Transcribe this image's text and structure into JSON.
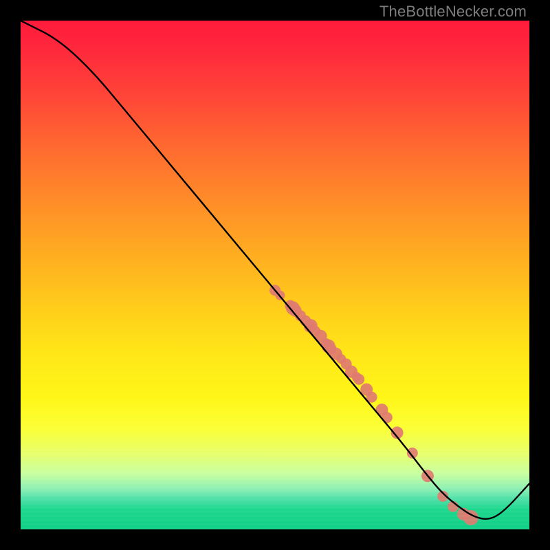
{
  "watermark": "TheBottleNecker.com",
  "chart_data": {
    "type": "line",
    "title": "",
    "xlabel": "",
    "ylabel": "",
    "xlim": [
      0,
      100
    ],
    "ylim": [
      0,
      100
    ],
    "grid": false,
    "legend": false,
    "background_gradient": {
      "top": "#ff1a3c",
      "mid": "#ffd21a",
      "bottom": "#10cf86"
    },
    "series": [
      {
        "name": "curve",
        "color": "#000000",
        "x": [
          0,
          3,
          6,
          10,
          15,
          20,
          25,
          30,
          35,
          40,
          45,
          50,
          55,
          60,
          65,
          70,
          75,
          80,
          83,
          86,
          89,
          92,
          95,
          100
        ],
        "y": [
          100,
          98.5,
          97,
          94,
          89,
          83,
          77,
          71,
          65,
          59,
          53,
          47,
          41,
          35,
          29,
          23,
          17,
          10.5,
          7,
          4.5,
          2.5,
          1.8,
          3.5,
          9
        ]
      }
    ],
    "points": {
      "name": "data-points",
      "color": "#e07b70",
      "x": [
        50,
        51,
        53,
        53.5,
        54,
        55,
        56,
        57,
        57,
        58,
        59,
        60,
        60.5,
        61,
        62,
        63,
        64,
        65,
        66,
        66.5,
        68,
        69,
        71,
        72,
        74,
        77,
        80,
        83,
        85,
        87,
        88.5
      ],
      "y": [
        47,
        46,
        44,
        43.5,
        43,
        42,
        41,
        40,
        40,
        39,
        38,
        36.5,
        36,
        35.5,
        34.5,
        33.5,
        32.5,
        31,
        30,
        29.5,
        27.5,
        26,
        23.5,
        22,
        19,
        15,
        10.5,
        6.5,
        4.5,
        3,
        2.3
      ],
      "r": [
        8,
        7,
        8,
        10,
        9,
        8,
        8,
        10,
        7,
        7,
        9,
        8,
        10,
        8,
        9,
        7,
        8,
        9,
        7,
        8,
        9,
        8,
        9,
        8,
        9,
        8,
        9,
        8,
        8,
        9,
        11
      ]
    }
  }
}
